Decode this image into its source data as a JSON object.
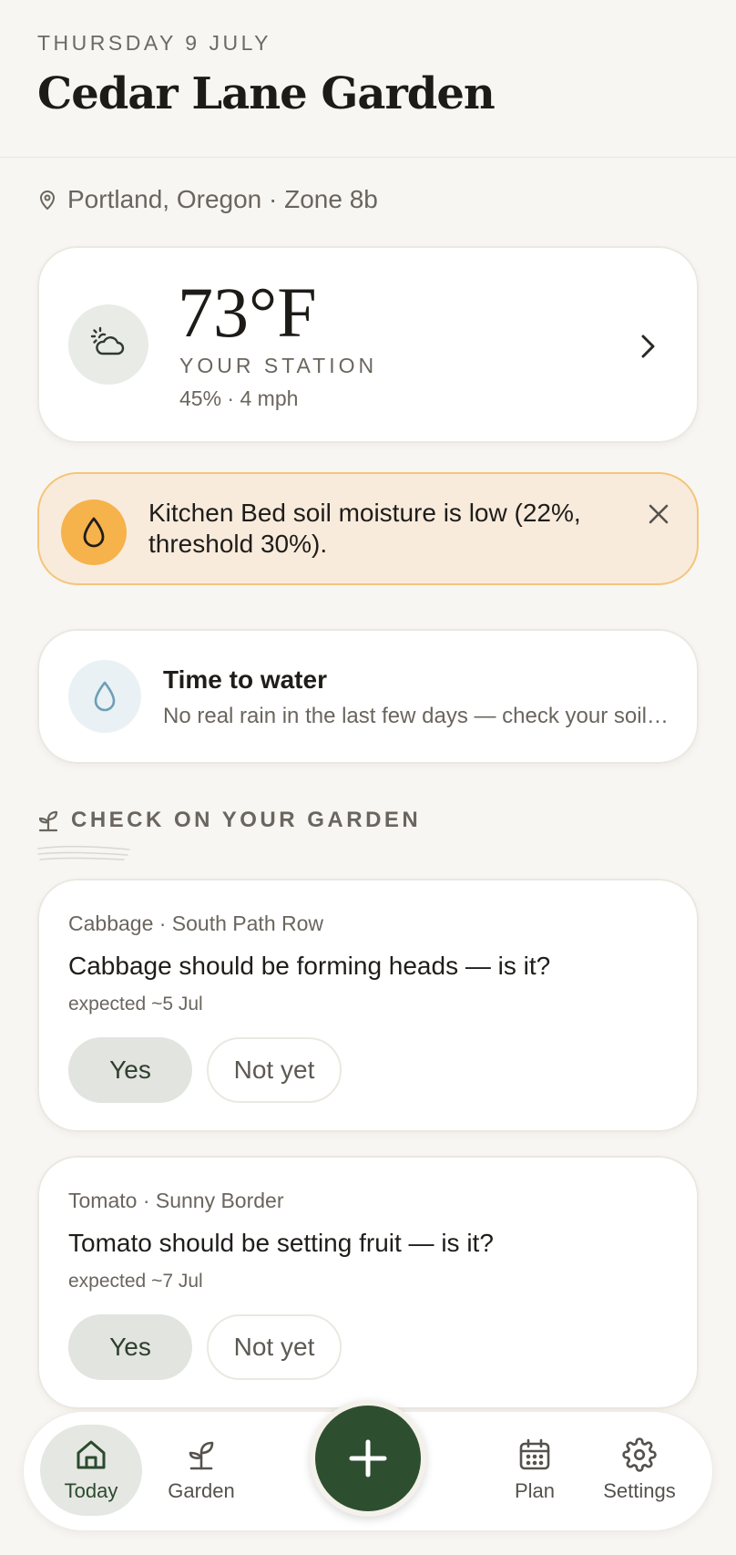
{
  "header": {
    "date": "THURSDAY 9 JULY",
    "title": "Cedar Lane Garden"
  },
  "location": {
    "text": "Portland, Oregon · Zone 8b"
  },
  "weather": {
    "temperature": "73°F",
    "station": "YOUR STATION",
    "meta": "45% · 4 mph"
  },
  "alert": {
    "message": "Kitchen Bed soil moisture is low (22%, threshold 30%)."
  },
  "water": {
    "title": "Time to water",
    "subtitle": "No real rain in the last few days — check your soil before watering"
  },
  "section": {
    "title": "CHECK ON YOUR GARDEN"
  },
  "checks": [
    {
      "subtitle": "Cabbage · South Path Row",
      "question": "Cabbage should be forming heads — is it?",
      "expected": "expected ~5 Jul",
      "yes_label": "Yes",
      "no_label": "Not yet"
    },
    {
      "subtitle": "Tomato · Sunny Border",
      "question": "Tomato should be setting fruit — is it?",
      "expected": "expected ~7 Jul",
      "yes_label": "Yes",
      "no_label": "Not yet"
    }
  ],
  "nav": {
    "today": "Today",
    "garden": "Garden",
    "plan": "Plan",
    "settings": "Settings"
  },
  "icons": {
    "location": "map-pin-icon",
    "weather": "partly-sunny-icon",
    "alert": "water-drop-icon",
    "water": "water-drop-icon",
    "section": "sprout-icon",
    "fab": "plus-icon"
  },
  "colors": {
    "accent": "#2e4f2f",
    "alert_bg": "#f8ebdc",
    "alert_border": "#f4c57a",
    "alert_icon": "#f6b24b"
  }
}
